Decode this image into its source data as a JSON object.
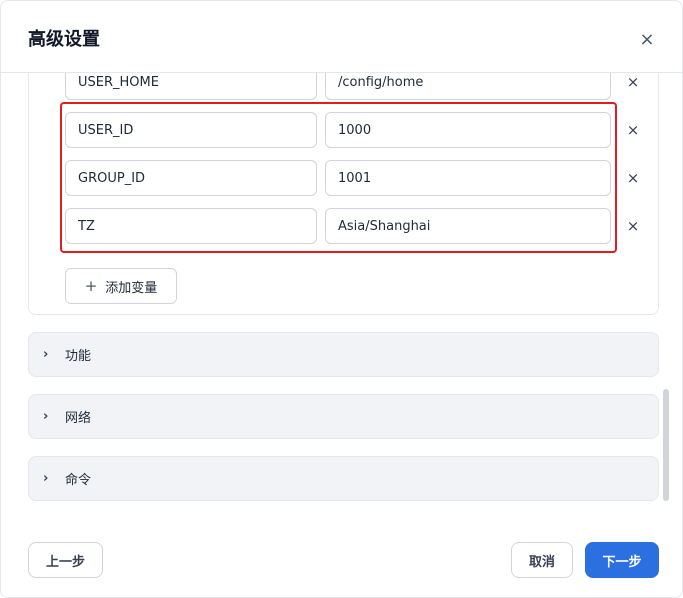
{
  "dialog": {
    "title": "高级设置",
    "close_icon": "×"
  },
  "env_vars": {
    "rows": [
      {
        "key": "USER_HOME",
        "value": "/config/home"
      },
      {
        "key": "USER_ID",
        "value": "1000"
      },
      {
        "key": "GROUP_ID",
        "value": "1001"
      },
      {
        "key": "TZ",
        "value": "Asia/Shanghai"
      }
    ],
    "remove_icon": "×",
    "add_icon": "+",
    "add_label": "添加变量"
  },
  "sections": [
    {
      "label": "功能",
      "icon": "chevron-right-icon",
      "glyph": "›"
    },
    {
      "label": "网络",
      "icon": "chevron-right-icon",
      "glyph": "›"
    },
    {
      "label": "命令",
      "icon": "chevron-right-icon",
      "glyph": "›"
    }
  ],
  "footer": {
    "prev_label": "上一步",
    "cancel_label": "取消",
    "next_label": "下一步"
  },
  "colors": {
    "primary": "#2b6fe0",
    "highlight": "#e11d1d",
    "section_bg": "#f1f3f7"
  }
}
